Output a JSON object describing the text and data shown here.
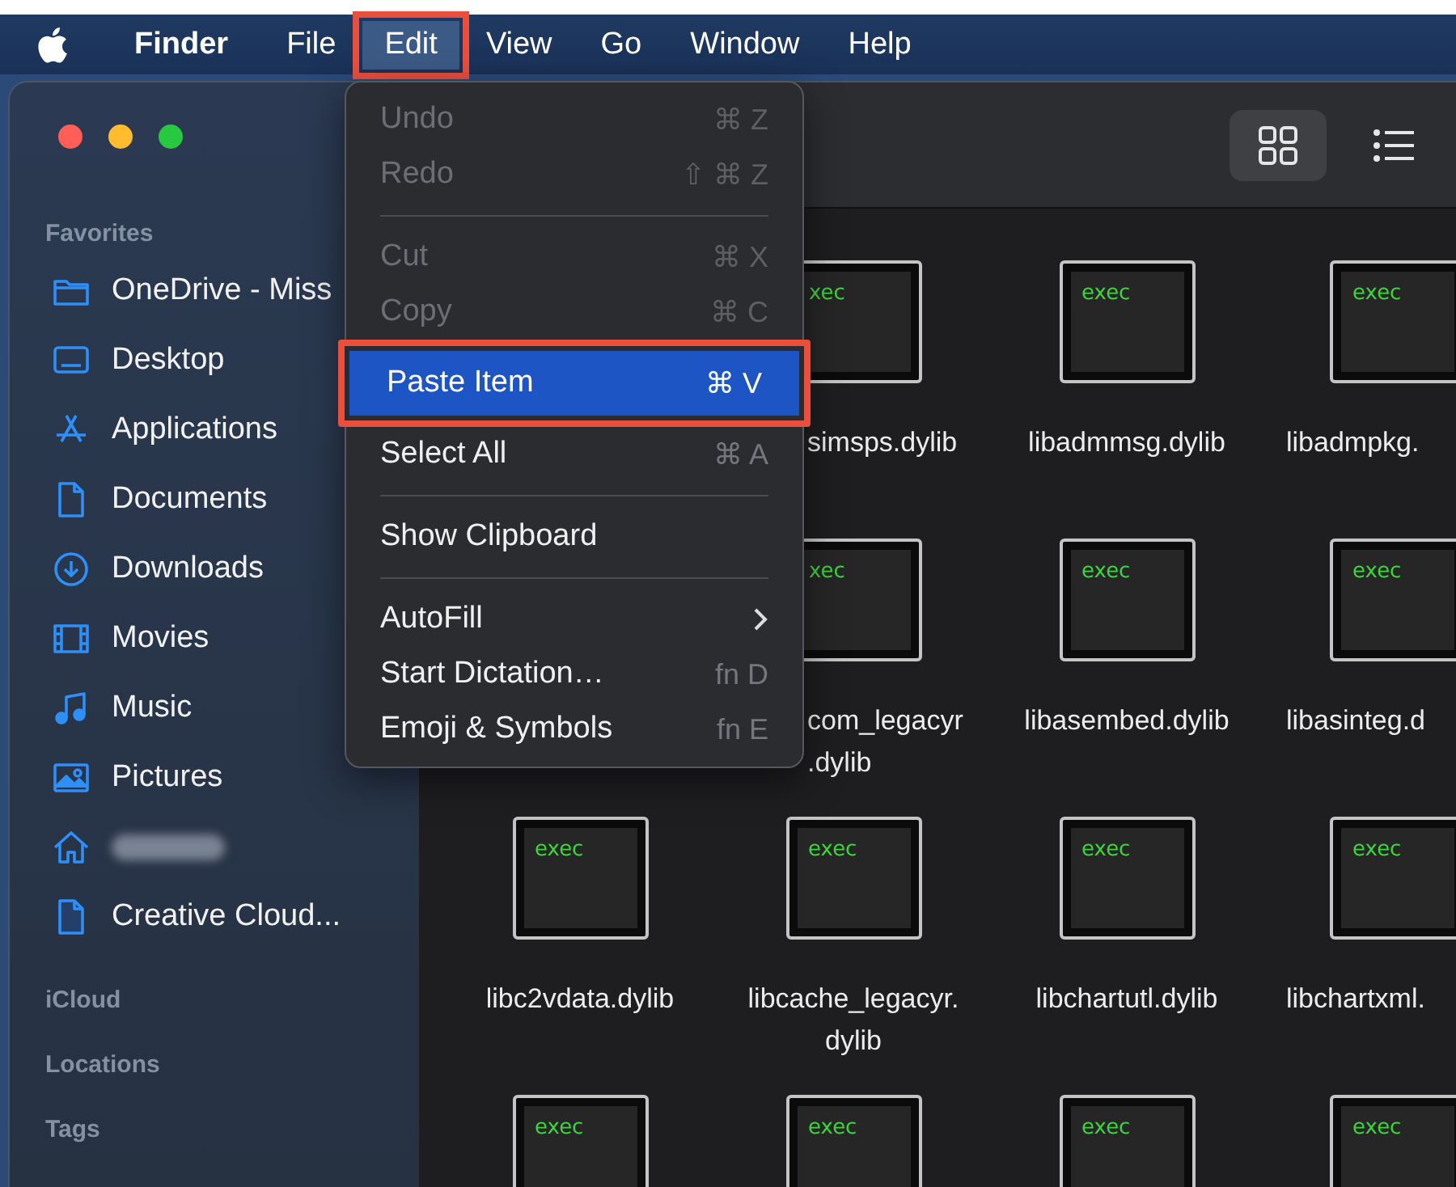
{
  "menubar": {
    "app": "Finder",
    "menus": [
      {
        "label": "File",
        "selected": false,
        "annotated": false
      },
      {
        "label": "Edit",
        "selected": true,
        "annotated": true
      },
      {
        "label": "View",
        "selected": false,
        "annotated": false
      },
      {
        "label": "Go",
        "selected": false,
        "annotated": false
      },
      {
        "label": "Window",
        "selected": false,
        "annotated": false
      },
      {
        "label": "Help",
        "selected": false,
        "annotated": false
      }
    ]
  },
  "edit_menu": {
    "items": [
      {
        "kind": "item",
        "label": "Undo",
        "shortcut": "⌘ Z",
        "disabled": true,
        "selected": false,
        "annotated": false,
        "submenu": false
      },
      {
        "kind": "item",
        "label": "Redo",
        "shortcut": "⇧ ⌘ Z",
        "disabled": true,
        "selected": false,
        "annotated": false,
        "submenu": false
      },
      {
        "kind": "separator"
      },
      {
        "kind": "item",
        "label": "Cut",
        "shortcut": "⌘ X",
        "disabled": true,
        "selected": false,
        "annotated": false,
        "submenu": false
      },
      {
        "kind": "item",
        "label": "Copy",
        "shortcut": "⌘ C",
        "disabled": true,
        "selected": false,
        "annotated": false,
        "submenu": false
      },
      {
        "kind": "item",
        "label": "Paste Item",
        "shortcut": "⌘ V",
        "disabled": false,
        "selected": true,
        "annotated": true,
        "submenu": false
      },
      {
        "kind": "item",
        "label": "Select All",
        "shortcut": "⌘ A",
        "disabled": false,
        "selected": false,
        "annotated": false,
        "submenu": false
      },
      {
        "kind": "separator"
      },
      {
        "kind": "item",
        "label": "Show Clipboard",
        "disabled": false,
        "selected": false,
        "annotated": false,
        "submenu": false
      },
      {
        "kind": "separator"
      },
      {
        "kind": "item",
        "label": "AutoFill",
        "disabled": false,
        "selected": false,
        "annotated": false,
        "submenu": true
      },
      {
        "kind": "item",
        "label": "Start Dictation…",
        "shortcut": "fn D",
        "disabled": false,
        "selected": false,
        "annotated": false,
        "submenu": false
      },
      {
        "kind": "item",
        "label": "Emoji & Symbols",
        "shortcut": "fn E",
        "disabled": false,
        "selected": false,
        "annotated": false,
        "submenu": false
      }
    ]
  },
  "toolbar": {
    "view_buttons": [
      {
        "selected": true
      },
      {
        "selected": false
      }
    ]
  },
  "sidebar": {
    "sections": [
      {
        "title": "Favorites",
        "items": [
          {
            "label": "OneDrive - Miss",
            "redacted": false
          },
          {
            "label": "Desktop",
            "redacted": false
          },
          {
            "label": "Applications",
            "redacted": false
          },
          {
            "label": "Documents",
            "redacted": false
          },
          {
            "label": "Downloads",
            "redacted": false
          },
          {
            "label": "Movies",
            "redacted": false
          },
          {
            "label": "Music",
            "redacted": false
          },
          {
            "label": "Pictures",
            "redacted": false
          },
          {
            "redacted": true
          },
          {
            "label": "Creative Cloud...",
            "redacted": false
          }
        ]
      },
      {
        "title": "iCloud"
      },
      {
        "title": "Locations"
      },
      {
        "title": "Tags"
      }
    ]
  },
  "files": {
    "rows": [
      {
        "files": [
          {
            "badge": "xec",
            "name": [
              "simsps.dylib"
            ]
          },
          {
            "badge": "exec",
            "name": [
              "libadmmsg.dylib"
            ]
          },
          {
            "badge": "exec",
            "name": [
              "libadmpkg."
            ]
          }
        ]
      },
      {
        "files": [
          {
            "badge": "xec",
            "name": [
              "com_legacyr",
              ".dylib"
            ]
          },
          {
            "badge": "exec",
            "name": [
              "libasembed.dylib"
            ]
          },
          {
            "badge": "exec",
            "name": [
              "libasinteg.d"
            ]
          }
        ]
      },
      {
        "files": [
          {
            "badge": "exec",
            "name": [
              "libc2vdata.dylib"
            ]
          },
          {
            "badge": "exec",
            "name": [
              "libcache_legacyr.",
              "dylib"
            ]
          },
          {
            "badge": "exec",
            "name": [
              "libchartutl.dylib"
            ]
          },
          {
            "badge": "exec",
            "name": [
              "libchartxml."
            ]
          }
        ]
      },
      {
        "files": [
          {
            "badge": "exec"
          },
          {
            "badge": "exec"
          },
          {
            "badge": "exec"
          },
          {
            "badge": "exec"
          }
        ]
      }
    ]
  }
}
